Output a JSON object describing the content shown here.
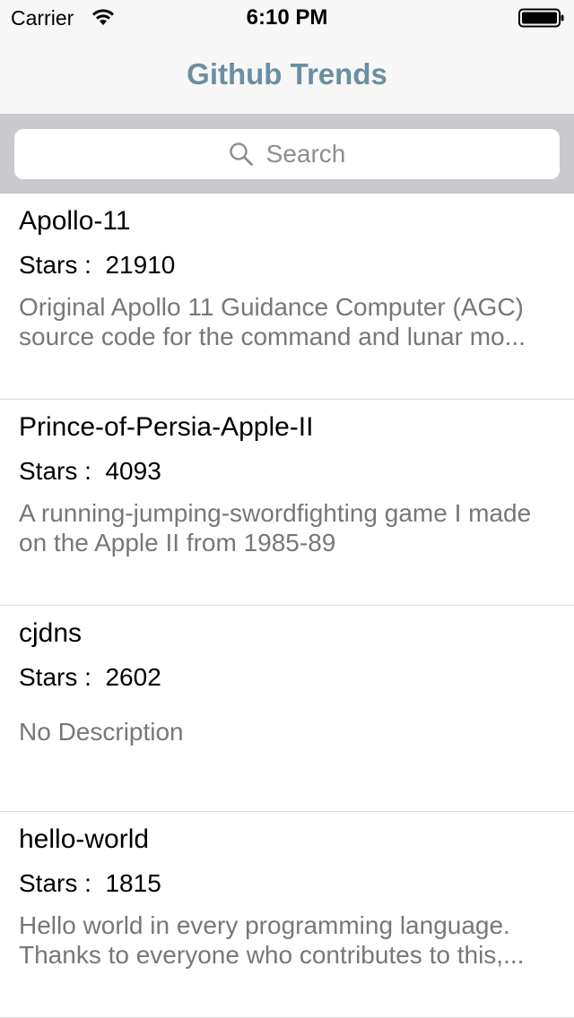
{
  "status_bar": {
    "carrier": "Carrier",
    "time": "6:10 PM"
  },
  "nav": {
    "title": "Github Trends",
    "title_color": "#6a8fa1"
  },
  "search": {
    "placeholder": "Search",
    "icon": "search-icon"
  },
  "repos": [
    {
      "name": "Apollo-11",
      "stars_label": "Stars :",
      "stars": "21910",
      "description": "Original Apollo 11 Guidance Computer (AGC) source code for the command and lunar mo..."
    },
    {
      "name": "Prince-of-Persia-Apple-II",
      "stars_label": "Stars :",
      "stars": "4093",
      "description": "A running-jumping-swordfighting game I made on the Apple II from 1985-89"
    },
    {
      "name": "cjdns",
      "stars_label": "Stars :",
      "stars": "2602",
      "description": "No Description"
    },
    {
      "name": "hello-world",
      "stars_label": "Stars :",
      "stars": "1815",
      "description": "Hello world in every programming language. Thanks to everyone who contributes to this,..."
    }
  ]
}
